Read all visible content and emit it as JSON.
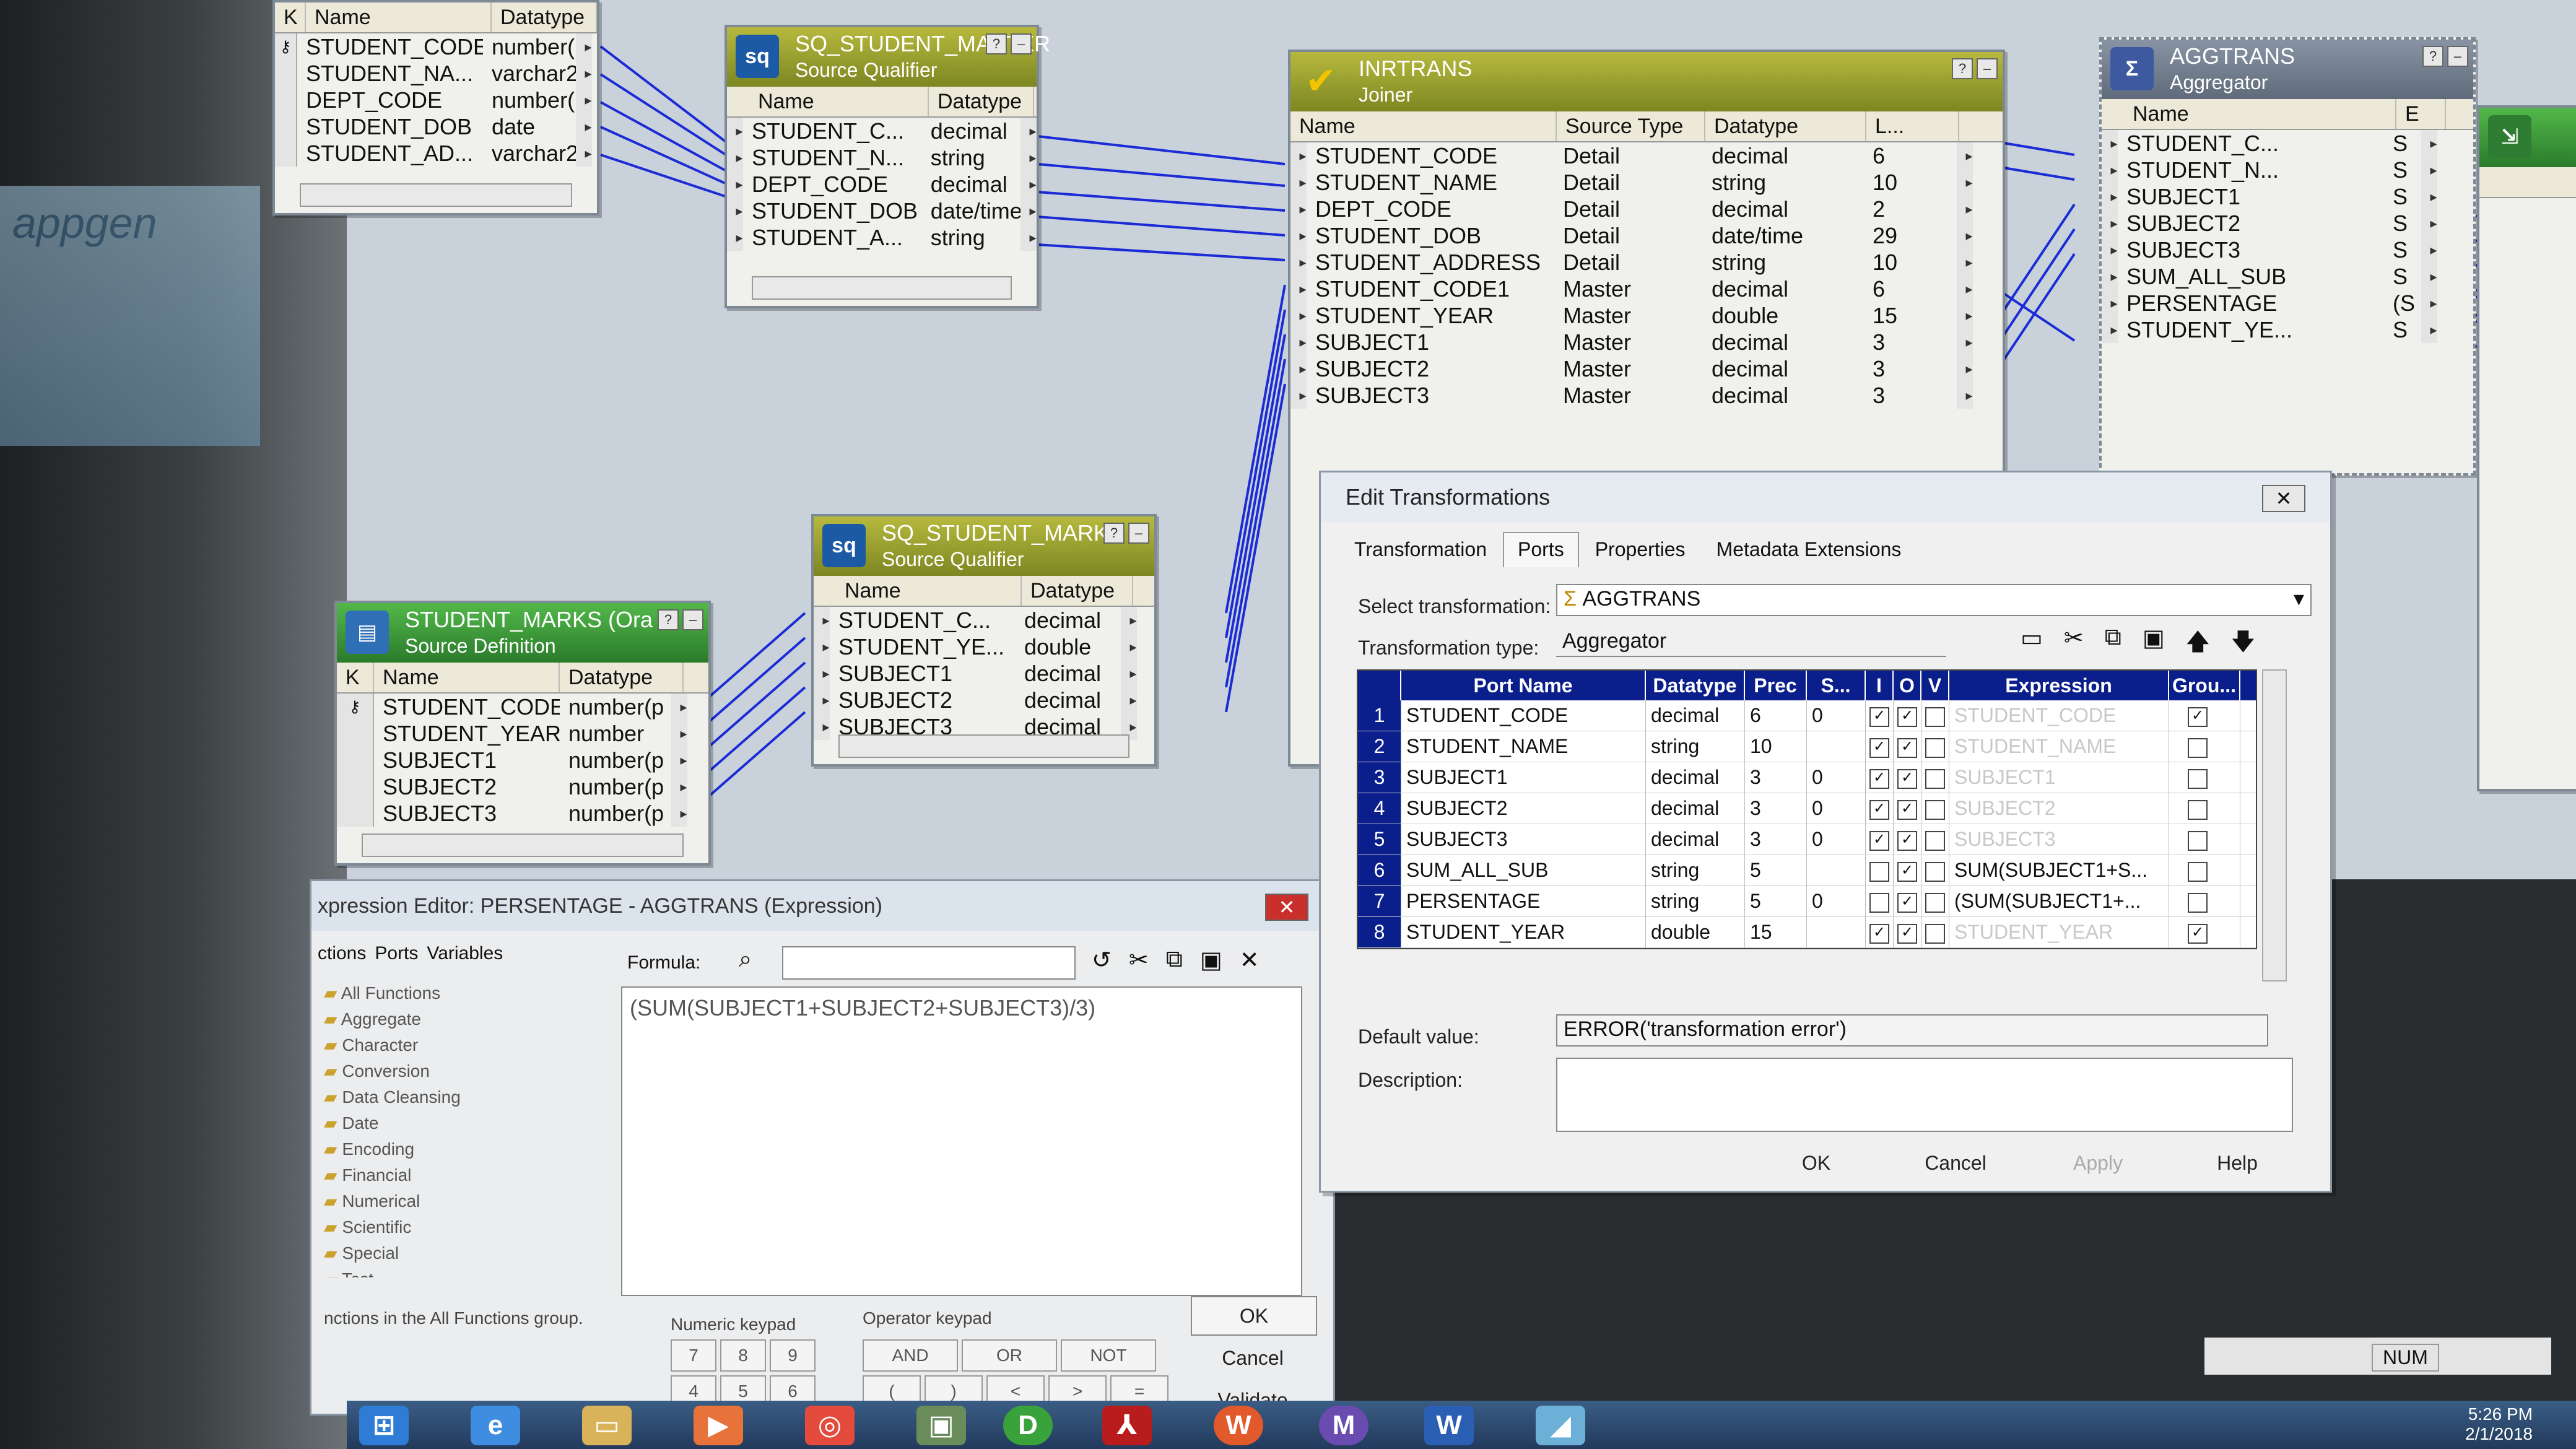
{
  "student_marks_table": {
    "headers": [
      "K",
      "Name",
      "Datatype"
    ],
    "rows": [
      {
        "name": "STUDENT_CODE",
        "type": "number(p"
      },
      {
        "name": "STUDENT_NA...",
        "type": "varchar2"
      },
      {
        "name": "DEPT_CODE",
        "type": "number(p"
      },
      {
        "name": "STUDENT_DOB",
        "type": "date"
      },
      {
        "name": "STUDENT_AD...",
        "type": "varchar2"
      }
    ]
  },
  "sq_student_master": {
    "title": "SQ_STUDENT_MASTER",
    "subtitle": "Source Qualifier",
    "headers": [
      "Name",
      "Datatype"
    ],
    "rows": [
      {
        "name": "STUDENT_C...",
        "type": "decimal"
      },
      {
        "name": "STUDENT_N...",
        "type": "string"
      },
      {
        "name": "DEPT_CODE",
        "type": "decimal"
      },
      {
        "name": "STUDENT_DOB",
        "type": "date/time"
      },
      {
        "name": "STUDENT_A...",
        "type": "string"
      }
    ]
  },
  "inrtrans": {
    "title": "INRTRANS",
    "subtitle": "Joiner",
    "headers": [
      "Name",
      "Source Type",
      "Datatype",
      "L..."
    ],
    "rows": [
      {
        "name": "STUDENT_CODE",
        "source": "Detail",
        "type": "decimal",
        "len": "6"
      },
      {
        "name": "STUDENT_NAME",
        "source": "Detail",
        "type": "string",
        "len": "10"
      },
      {
        "name": "DEPT_CODE",
        "source": "Detail",
        "type": "decimal",
        "len": "2"
      },
      {
        "name": "STUDENT_DOB",
        "source": "Detail",
        "type": "date/time",
        "len": "29"
      },
      {
        "name": "STUDENT_ADDRESS",
        "source": "Detail",
        "type": "string",
        "len": "10"
      },
      {
        "name": "STUDENT_CODE1",
        "source": "Master",
        "type": "decimal",
        "len": "6"
      },
      {
        "name": "STUDENT_YEAR",
        "source": "Master",
        "type": "double",
        "len": "15"
      },
      {
        "name": "SUBJECT1",
        "source": "Master",
        "type": "decimal",
        "len": "3"
      },
      {
        "name": "SUBJECT2",
        "source": "Master",
        "type": "decimal",
        "len": "3"
      },
      {
        "name": "SUBJECT3",
        "source": "Master",
        "type": "decimal",
        "len": "3"
      }
    ]
  },
  "aggtrans": {
    "title": "AGGTRANS",
    "subtitle": "Aggregator",
    "headers": [
      "Name",
      "E"
    ],
    "rows": [
      {
        "name": "STUDENT_C...",
        "e": "S"
      },
      {
        "name": "STUDENT_N...",
        "e": "S"
      },
      {
        "name": "SUBJECT1",
        "e": "S"
      },
      {
        "name": "SUBJECT2",
        "e": "S"
      },
      {
        "name": "SUBJECT3",
        "e": "S"
      },
      {
        "name": "SUM_ALL_SUB",
        "e": "S"
      },
      {
        "name": "PERSENTAGE",
        "e": "(S"
      },
      {
        "name": "STUDENT_YE...",
        "e": "S"
      }
    ]
  },
  "sq_student_marks": {
    "title": "SQ_STUDENT_MARKS",
    "subtitle": "Source Qualifier",
    "headers": [
      "Name",
      "Datatype"
    ],
    "rows": [
      {
        "name": "STUDENT_C...",
        "type": "decimal"
      },
      {
        "name": "STUDENT_YE...",
        "type": "double"
      },
      {
        "name": "SUBJECT1",
        "type": "decimal"
      },
      {
        "name": "SUBJECT2",
        "type": "decimal"
      },
      {
        "name": "SUBJECT3",
        "type": "decimal"
      }
    ]
  },
  "student_marks_source": {
    "title": "STUDENT_MARKS (Ora",
    "subtitle": "Source Definition",
    "headers": [
      "K",
      "Name",
      "Datatype"
    ],
    "rows": [
      {
        "name": "STUDENT_CODE",
        "type": "number(p"
      },
      {
        "name": "STUDENT_YEAR",
        "type": "number"
      },
      {
        "name": "SUBJECT1",
        "type": "number(p"
      },
      {
        "name": "SUBJECT2",
        "type": "number(p"
      },
      {
        "name": "SUBJECT3",
        "type": "number(p"
      }
    ]
  },
  "edit_dialog": {
    "title": "Edit Transformations",
    "tabs": [
      "Transformation",
      "Ports",
      "Properties",
      "Metadata Extensions"
    ],
    "select_label": "Select transformation:",
    "select_value": "AGGTRANS",
    "type_label": "Transformation type:",
    "type_value": "Aggregator",
    "grid_headers": [
      "Port Name",
      "Datatype",
      "Prec",
      "S...",
      "I",
      "O",
      "V",
      "Expression",
      "Grou..."
    ],
    "ports": [
      {
        "num": "1",
        "name": "STUDENT_CODE",
        "type": "decimal",
        "prec": "6",
        "scale": "0",
        "i": true,
        "o": true,
        "v": false,
        "expr": "STUDENT_CODE",
        "expr_dim": true,
        "group": true
      },
      {
        "num": "2",
        "name": "STUDENT_NAME",
        "type": "string",
        "prec": "10",
        "scale": "",
        "i": true,
        "o": true,
        "v": false,
        "expr": "STUDENT_NAME",
        "expr_dim": true,
        "group": false
      },
      {
        "num": "3",
        "name": "SUBJECT1",
        "type": "decimal",
        "prec": "3",
        "scale": "0",
        "i": true,
        "o": true,
        "v": false,
        "expr": "SUBJECT1",
        "expr_dim": true,
        "group": false
      },
      {
        "num": "4",
        "name": "SUBJECT2",
        "type": "decimal",
        "prec": "3",
        "scale": "0",
        "i": true,
        "o": true,
        "v": false,
        "expr": "SUBJECT2",
        "expr_dim": true,
        "group": false
      },
      {
        "num": "5",
        "name": "SUBJECT3",
        "type": "decimal",
        "prec": "3",
        "scale": "0",
        "i": true,
        "o": true,
        "v": false,
        "expr": "SUBJECT3",
        "expr_dim": true,
        "group": false
      },
      {
        "num": "6",
        "name": "SUM_ALL_SUB",
        "type": "string",
        "prec": "5",
        "scale": "",
        "i": false,
        "o": true,
        "v": false,
        "expr": "SUM(SUBJECT1+S...",
        "expr_dim": false,
        "group": false
      },
      {
        "num": "7",
        "name": "PERSENTAGE",
        "type": "string",
        "prec": "5",
        "scale": "0",
        "i": false,
        "o": true,
        "v": false,
        "expr": "(SUM(SUBJECT1+...",
        "expr_dim": false,
        "group": false
      },
      {
        "num": "8",
        "name": "STUDENT_YEAR",
        "type": "double",
        "prec": "15",
        "scale": "",
        "i": true,
        "o": true,
        "v": false,
        "expr": "STUDENT_YEAR",
        "expr_dim": true,
        "group": true
      }
    ],
    "default_label": "Default value:",
    "default_value": "ERROR('transformation error')",
    "description_label": "Description:",
    "buttons": {
      "ok": "OK",
      "cancel": "Cancel",
      "apply": "Apply",
      "help": "Help"
    }
  },
  "expression_editor": {
    "title": "xpression Editor: PERSENTAGE - AGGTRANS (Expression)",
    "tabs": [
      "ctions",
      "Ports",
      "Variables"
    ],
    "formula_label": "Formula:",
    "formula": "(SUM(SUBJECT1+SUBJECT2+SUBJECT3)/3)",
    "functions": [
      "All Functions",
      "Aggregate",
      "Character",
      "Conversion",
      "Data Cleansing",
      "Date",
      "Encoding",
      "Financial",
      "Numerical",
      "Scientific",
      "Special",
      "Test"
    ],
    "footer_hint": "nctions in the All Functions group.",
    "numeric_keypad_label": "Numeric keypad",
    "operator_keypad_label": "Operator keypad",
    "numeric_keys": [
      "7",
      "8",
      "9",
      "4",
      "5",
      "6"
    ],
    "operator_keys": [
      "AND",
      "OR",
      "NOT",
      "(",
      ")",
      "<",
      ">",
      "=",
      "!="
    ],
    "buttons": {
      "ok": "OK",
      "cancel": "Cancel",
      "validate": "Validate"
    }
  },
  "status": {
    "num": "NUM",
    "time": "5:26 PM",
    "date": "2/1/2018"
  },
  "desktop_peek_text": "appgen",
  "colors": {
    "canvas": "#c9d2db",
    "grid_header": "#0a1e8c",
    "link": "#1b2bd6"
  }
}
